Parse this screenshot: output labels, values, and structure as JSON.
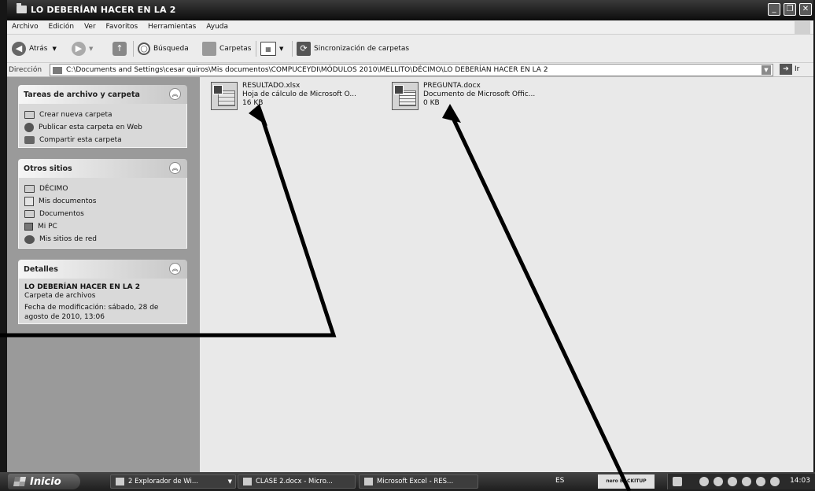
{
  "window": {
    "title": "LO DEBERÍAN HACER EN LA 2",
    "buttons": {
      "minimize": "_",
      "maximize": "❐",
      "close": "✕"
    }
  },
  "menu": [
    "Archivo",
    "Edición",
    "Ver",
    "Favoritos",
    "Herramientas",
    "Ayuda"
  ],
  "toolbar": {
    "back_label": "Atrás",
    "search_label": "Búsqueda",
    "folders_label": "Carpetas",
    "sync_label": "Sincronización de carpetas"
  },
  "address": {
    "label": "Dirección",
    "path": "C:\\Documents and Settings\\cesar quiros\\Mis documentos\\COMPUCEYDI\\MÓDULOS 2010\\MELLITO\\DÉCIMO\\LO DEBERÍAN HACER EN LA 2",
    "go_label": "Ir"
  },
  "panels": {
    "tasks": {
      "title": "Tareas de archivo y carpeta",
      "items": [
        "Crear nueva carpeta",
        "Publicar esta carpeta en Web",
        "Compartir esta carpeta"
      ]
    },
    "places": {
      "title": "Otros sitios",
      "items": [
        "DÉCIMO",
        "Mis documentos",
        "Documentos",
        "Mi PC",
        "Mis sitios de red"
      ]
    },
    "details": {
      "title": "Detalles",
      "name": "LO DEBERÍAN HACER EN LA 2",
      "type": "Carpeta de archivos",
      "modified_line1": "Fecha de modificación: sábado, 28 de",
      "modified_line2": "agosto de 2010, 13:06"
    }
  },
  "files": [
    {
      "name": "RESULTADO.xlsx",
      "type": "Hoja de cálculo de Microsoft O...",
      "size": "16 KB",
      "icon": "excel-file-icon"
    },
    {
      "name": "PREGUNTA.docx",
      "type": "Documento de Microsoft Offic...",
      "size": "0 KB",
      "icon": "word-file-icon"
    }
  ],
  "taskbar": {
    "start_label": "Inicio",
    "tasks": [
      "2 Explorador de Wi...",
      "CLASE 2.docx - Micro...",
      "Microsoft Excel - RES..."
    ],
    "language": "ES",
    "nero_label": "nero BACKITUP",
    "clock": "14:03"
  }
}
